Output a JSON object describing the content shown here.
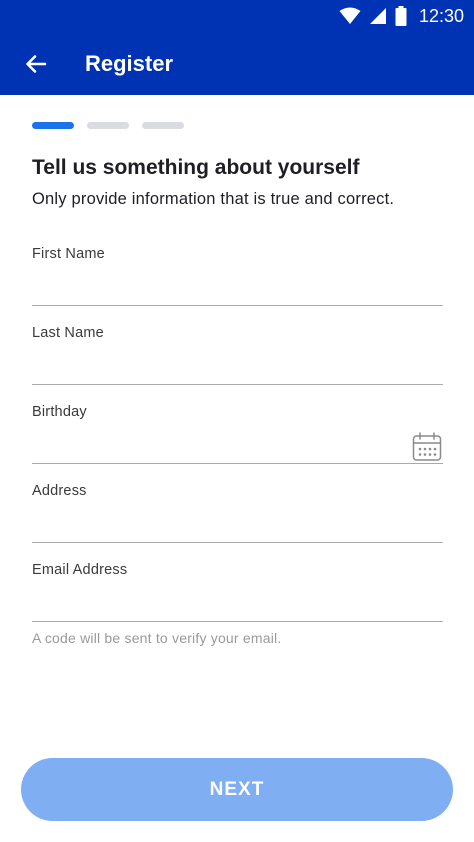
{
  "status_bar": {
    "time": "12:30"
  },
  "app_bar": {
    "title": "Register"
  },
  "progress": {
    "total_steps": 3,
    "current_step": 1
  },
  "content": {
    "heading": "Tell us something about yourself",
    "subheading": "Only provide information that is true and correct."
  },
  "form": {
    "first_name": {
      "label": "First Name",
      "value": ""
    },
    "last_name": {
      "label": "Last Name",
      "value": ""
    },
    "birthday": {
      "label": "Birthday",
      "value": ""
    },
    "address": {
      "label": "Address",
      "value": ""
    },
    "email": {
      "label": "Email Address",
      "value": "",
      "helper": "A code will be sent to verify your email."
    }
  },
  "actions": {
    "next_label": "NEXT"
  },
  "colors": {
    "primary": "#0033b3",
    "step_active": "#1a73e8",
    "step_inactive": "#d9dce1",
    "button_disabled": "#7faef2"
  },
  "icons": [
    "back-arrow-icon",
    "wifi-icon",
    "signal-icon",
    "battery-icon",
    "calendar-icon"
  ]
}
